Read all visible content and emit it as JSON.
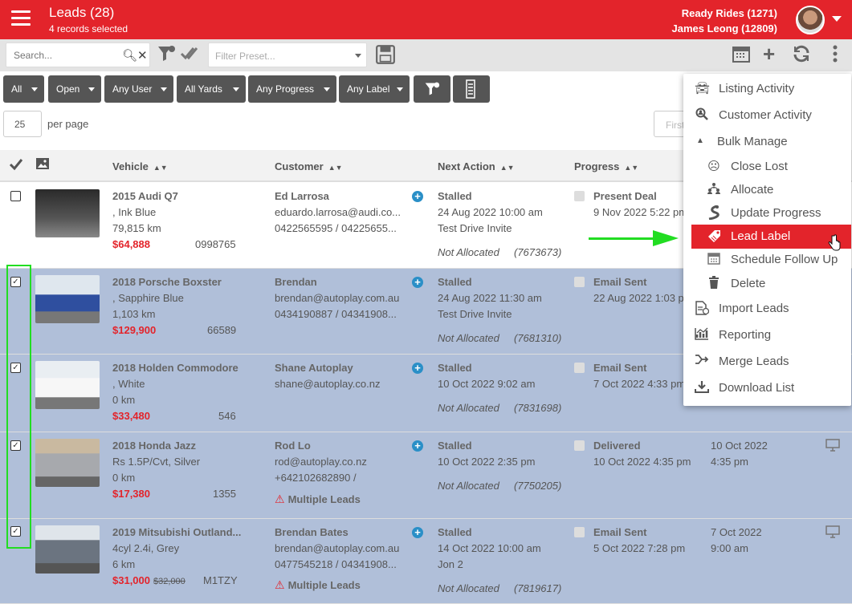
{
  "header": {
    "title": "Leads (28)",
    "subtitle": "4 records selected",
    "account": "Ready Rides (1271)",
    "user": "James Leong (12809)"
  },
  "toolbar": {
    "search_placeholder": "Search...",
    "preset_placeholder": "Filter Preset...",
    "icons": [
      "search-icon",
      "clear-icon",
      "filter-icon",
      "check-all-icon",
      "save-icon",
      "calendar-icon",
      "add-icon",
      "refresh-icon",
      "more-vertical-icon"
    ]
  },
  "filters": [
    "All",
    "Open",
    "Any User",
    "All Yards",
    "Any Progress",
    "Any Label"
  ],
  "paging": {
    "per_page_value": "25",
    "per_page_label": "per page",
    "first": "First"
  },
  "columns": {
    "vehicle": "Vehicle",
    "customer": "Customer",
    "next_action": "Next Action",
    "progress": "Progress"
  },
  "rows": [
    {
      "title": "2015 Audi Q7",
      "color": ", Ink Blue",
      "km": "79,815 km",
      "price": "$64,888",
      "old_price": "",
      "stock": "0998765",
      "customer": "Ed Larrosa",
      "email": "eduardo.larrosa@audi.co...",
      "phone": "0422565595 / 04225655...",
      "warn": "",
      "action": "Stalled",
      "action_date": "24 Aug 2022 10:00 am",
      "action_detail": "Test Drive Invite",
      "alloc": "Not Allocated",
      "ref": "(7673673)",
      "progress": "Present Deal",
      "progress_date": "9 Nov 2022 5:22 pm",
      "extra1": "",
      "extra2": "",
      "selected": false
    },
    {
      "title": "2018 Porsche Boxster",
      "color": ", Sapphire Blue",
      "km": "1,103 km",
      "price": "$129,900",
      "old_price": "",
      "stock": "66589",
      "customer": "Brendan",
      "email": "brendan@autoplay.com.au",
      "phone": "0434190887 / 04341908...",
      "warn": "",
      "action": "Stalled",
      "action_date": "24 Aug 2022 11:30 am",
      "action_detail": "Test Drive Invite",
      "alloc": "Not Allocated",
      "ref": "(7681310)",
      "progress": "Email Sent",
      "progress_date": "22 Aug 2022 1:03 p",
      "extra1": "",
      "extra2": "",
      "selected": true
    },
    {
      "title": "2018 Holden Commodore",
      "color": ", White",
      "km": "0 km",
      "price": "$33,480",
      "old_price": "",
      "stock": "546",
      "customer": "Shane Autoplay",
      "email": "shane@autoplay.co.nz",
      "phone": "",
      "warn": "",
      "action": "Stalled",
      "action_date": "10 Oct 2022 9:02 am",
      "action_detail": "",
      "alloc": "Not Allocated",
      "ref": "(7831698)",
      "progress": "Email Sent",
      "progress_date": "7 Oct 2022 4:33 pm",
      "extra1": "",
      "extra2": "",
      "selected": true
    },
    {
      "title": "2018 Honda Jazz",
      "color": "Rs 1.5P/Cvt, Silver",
      "km": "0 km",
      "price": "$17,380",
      "old_price": "",
      "stock": "1355",
      "customer": "Rod Lo",
      "email": "rod@autoplay.co.nz",
      "phone": "+642102682890 /",
      "warn": "Multiple Leads",
      "action": "Stalled",
      "action_date": "10 Oct 2022 2:35 pm",
      "action_detail": "",
      "alloc": "Not Allocated",
      "ref": "(7750205)",
      "progress": "Delivered",
      "progress_date": "10 Oct 2022 4:35 pm",
      "extra1": "10 Oct 2022",
      "extra2": "4:35 pm",
      "selected": true
    },
    {
      "title": "2019 Mitsubishi Outland...",
      "color": "4cyl 2.4i, Grey",
      "km": "6 km",
      "price": "$31,000",
      "old_price": "$32,000",
      "stock": "M1TZY",
      "customer": "Brendan Bates",
      "email": "brendan@autoplay.com.au",
      "phone": "0477545218 / 04341908...",
      "warn": "Multiple Leads",
      "action": "Stalled",
      "action_date": "14 Oct 2022 10:00 am",
      "action_detail": "Jon 2",
      "alloc": "Not Allocated",
      "ref": "(7819617)",
      "progress": "Email Sent",
      "progress_date": "5 Oct 2022 7:28 pm",
      "extra1": "7 Oct 2022",
      "extra2": "9:00 am",
      "selected": true
    }
  ],
  "menu": {
    "listing_activity": "Listing Activity",
    "customer_activity": "Customer Activity",
    "bulk_manage": "Bulk Manage",
    "close_lost": "Close Lost",
    "allocate": "Allocate",
    "update_progress": "Update Progress",
    "lead_label": "Lead Label",
    "schedule_follow_up": "Schedule Follow Up",
    "delete": "Delete",
    "import_leads": "Import Leads",
    "reporting": "Reporting",
    "merge_leads": "Merge Leads",
    "download_list": "Download List"
  },
  "colors": {
    "brand_red": "#e3242b",
    "selected_row": "#b0bfd9",
    "highlight_green": "#22dd22"
  }
}
